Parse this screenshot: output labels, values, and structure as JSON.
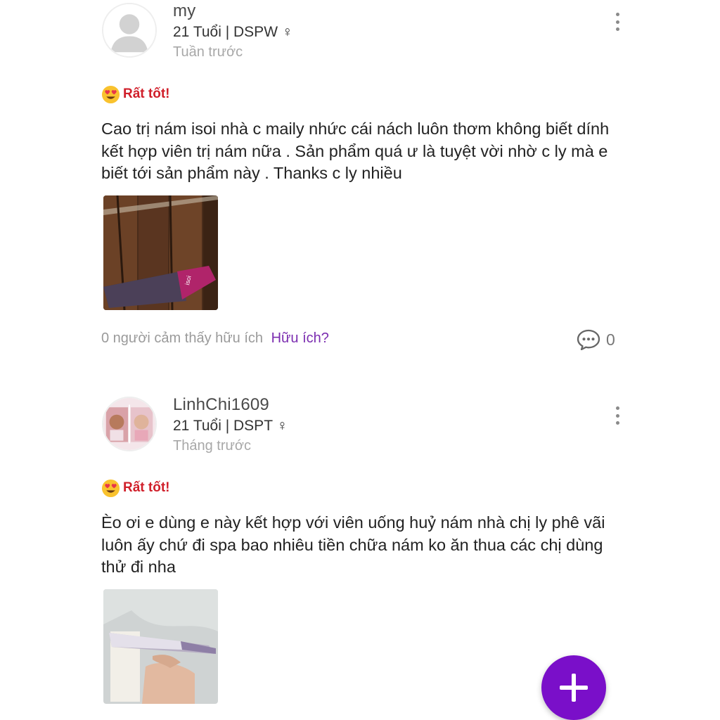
{
  "reviews": [
    {
      "username": "my",
      "meta": "21 Tuổi | DSPW ♀",
      "time": "Tuần trước",
      "rating_label": "Rất tốt!",
      "content": "Cao trị nám isoi nhà c maily nhức cái nách luôn thơm không biết dính kết hợp viên trị nám nữa . Sản phẩm quá ư là tuyệt vời nhờ c ly mà e biết tới sản phẩm này . Thanks c ly nhiều",
      "helpful_count_text": "0 người cảm thấy hữu ích",
      "helpful_link": "Hữu ích?",
      "comment_count": "0"
    },
    {
      "username": "LinhChi1609",
      "meta": "21 Tuổi | DSPT ♀",
      "time": "Tháng trước",
      "rating_label": "Rất tốt!",
      "content": "Èo ơi e dùng e này kết hợp với viên uống huỷ nám nhà chị ly phê vãi luôn ấy chứ đi spa bao nhiêu tiền chữa nám ko ăn thua các chị dùng thử đi nha"
    }
  ],
  "colors": {
    "rating_red": "#d01f2a",
    "helpful_link_purple": "#7b2db0",
    "fab_purple": "#7a0fc9"
  },
  "icons": {
    "more": "more-vertical-icon",
    "comment": "comment-bubble-icon",
    "emoji": "smiling-heart-eyes-emoji-icon",
    "fab": "plus-icon"
  }
}
